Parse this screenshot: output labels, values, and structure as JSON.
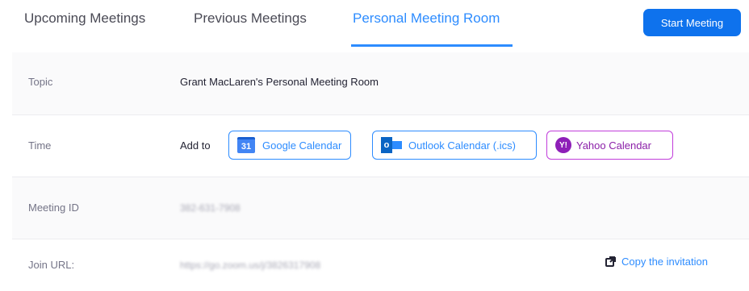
{
  "tabs": {
    "upcoming": "Upcoming Meetings",
    "previous": "Previous Meetings",
    "personal": "Personal Meeting Room"
  },
  "start_button": "Start Meeting",
  "topic": {
    "label": "Topic",
    "value": "Grant MacLaren's Personal Meeting Room"
  },
  "time": {
    "label": "Time",
    "add_to": "Add to",
    "google": "Google Calendar",
    "google_icon_text": "31",
    "outlook": "Outlook Calendar (.ics)",
    "outlook_icon_text": "o",
    "yahoo": "Yahoo Calendar",
    "yahoo_icon_text": "Y!"
  },
  "meeting_id": {
    "label": "Meeting ID",
    "value": "382-631-7908"
  },
  "join_url": {
    "label": "Join URL:",
    "value": "https://go.zoom.us/j/3826317908",
    "copy": "Copy the invitation"
  },
  "colors": {
    "accent": "#2d8cff",
    "button": "#0e72ed",
    "yahoo": "#8e1fb8"
  }
}
